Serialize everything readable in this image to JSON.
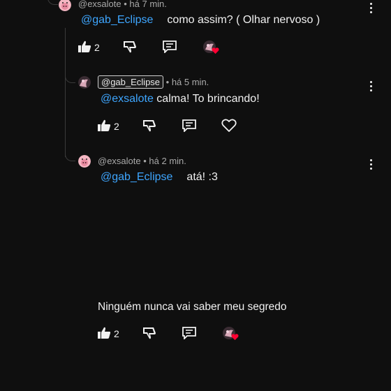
{
  "comments": [
    {
      "handle": "@exsalote",
      "time": "• há 7 min.",
      "mention": "@gab_Eclipse",
      "text": "como assim? ( Olhar nervoso )",
      "likes": "2",
      "has_heart": true
    },
    {
      "handle": "@gab_Eclipse",
      "time": "• há 5 min.",
      "mention": "@exsalote",
      "text": "calma! To brincando!",
      "likes": "2",
      "has_heart": false
    },
    {
      "handle": "@exsalote",
      "time": "• há 2 min.",
      "mention": "@gab_Eclipse",
      "text": "atá! :3",
      "likes": "",
      "has_heart": false
    },
    {
      "text": "Ninguém nunca vai saber meu segredo",
      "likes": "2",
      "has_heart": true
    }
  ],
  "icons": {
    "like": "thumbs-up-icon",
    "dislike": "thumbs-down-icon",
    "reply": "reply-icon",
    "heart": "heart-icon",
    "more": "more-vertical-icon"
  },
  "colors": {
    "background": "#0f0f0f",
    "mention": "#3ea6ff",
    "creator_heart": "#ff0033"
  }
}
